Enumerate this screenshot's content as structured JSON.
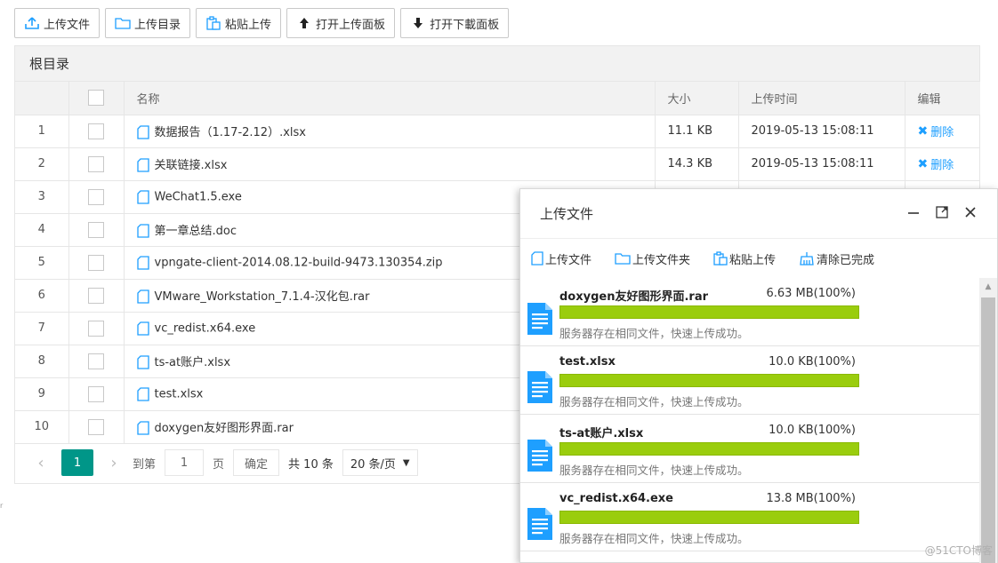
{
  "toolbar": {
    "upload_file": "上传文件",
    "upload_dir": "上传目录",
    "paste_upload": "粘贴上传",
    "open_upload_panel": "打开上传面板",
    "open_download_panel": "打开下載面板"
  },
  "panel": {
    "title": "根目录",
    "columns": {
      "name": "名称",
      "size": "大小",
      "time": "上传时间",
      "edit": "编辑"
    },
    "delete_label": "删除",
    "rows": [
      {
        "num": "1",
        "name": "数据报告（1.17-2.12）.xlsx",
        "size": "11.1 KB",
        "time": "2019-05-13 15:08:11",
        "deletable": true
      },
      {
        "num": "2",
        "name": "关联链接.xlsx",
        "size": "14.3 KB",
        "time": "2019-05-13 15:08:11",
        "deletable": true
      },
      {
        "num": "3",
        "name": "WeChat1.5.exe",
        "size": "",
        "time": "",
        "deletable": false
      },
      {
        "num": "4",
        "name": "第一章总结.doc",
        "size": "",
        "time": "",
        "deletable": false
      },
      {
        "num": "5",
        "name": "vpngate-client-2014.08.12-build-9473.130354.zip",
        "size": "",
        "time": "",
        "deletable": false
      },
      {
        "num": "6",
        "name": "VMware_Workstation_7.1.4-汉化包.rar",
        "size": "",
        "time": "",
        "deletable": false
      },
      {
        "num": "7",
        "name": "vc_redist.x64.exe",
        "size": "",
        "time": "",
        "deletable": false
      },
      {
        "num": "8",
        "name": "ts-at账户.xlsx",
        "size": "",
        "time": "",
        "deletable": false
      },
      {
        "num": "9",
        "name": "test.xlsx",
        "size": "",
        "time": "",
        "deletable": false
      },
      {
        "num": "10",
        "name": "doxygen友好图形界面.rar",
        "size": "",
        "time": "",
        "deletable": false
      }
    ]
  },
  "pager": {
    "current": "1",
    "goto_label": "到第",
    "goto_value": "1",
    "page_label": "页",
    "confirm": "确定",
    "total": "共 10 条",
    "per_page": "20 条/页"
  },
  "dialog": {
    "title": "上传文件",
    "tools": {
      "upload_file": "上传文件",
      "upload_folder": "上传文件夹",
      "paste_upload": "粘贴上传",
      "clear_done": "清除已完成"
    },
    "items": [
      {
        "name": "doxygen友好图形界面.rar",
        "size": "6.63 MB(100%)",
        "progress": 1.0,
        "message": "服务器存在相同文件，快速上传成功。"
      },
      {
        "name": "test.xlsx",
        "size": "10.0 KB(100%)",
        "progress": 1.0,
        "message": "服务器存在相同文件，快速上传成功。"
      },
      {
        "name": "ts-at账户.xlsx",
        "size": "10.0 KB(100%)",
        "progress": 1.0,
        "message": "服务器存在相同文件，快速上传成功。"
      },
      {
        "name": "vc_redist.x64.exe",
        "size": "13.8 MB(100%)",
        "progress": 1.0,
        "message": "服务器存在相同文件，快速上传成功。"
      }
    ]
  },
  "watermark": "@51CTO博客",
  "colors": {
    "accent": "#1E9FFF",
    "pager_active": "#009688",
    "progress": "#9acd0d"
  }
}
